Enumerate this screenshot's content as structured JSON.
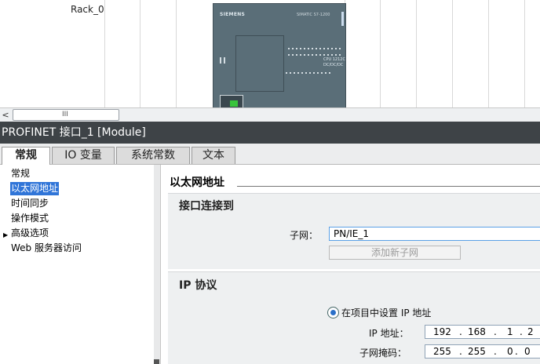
{
  "device_view": {
    "rack_label": "Rack_0",
    "plc": {
      "brand": "SIEMENS",
      "model": "SIMATIC S7-1200",
      "cpu_lines": [
        "CPU 1212C",
        "DC/DC/DC"
      ]
    }
  },
  "scrollbar": {
    "left_arrow": "<",
    "grip": "III"
  },
  "inspector": {
    "title": "PROFINET 接口_1 [Module]",
    "tabs": [
      {
        "label": "常规",
        "active": true
      },
      {
        "label": "IO 变量",
        "active": false
      },
      {
        "label": "系统常数",
        "active": false
      },
      {
        "label": "文本",
        "active": false
      }
    ]
  },
  "nav": {
    "items": [
      {
        "label": "常规",
        "selected": false
      },
      {
        "label": "以太网地址",
        "selected": true
      },
      {
        "label": "时间同步",
        "selected": false
      },
      {
        "label": "操作模式",
        "selected": false
      },
      {
        "label": "高级选项",
        "selected": false
      },
      {
        "label": "Web 服务器访问",
        "selected": false
      }
    ],
    "expand_arrow": "▶"
  },
  "content": {
    "section_title": "以太网地址",
    "interface_group": {
      "title": "接口连接到",
      "subnet_label": "子网：",
      "subnet_value": "PN/IE_1",
      "add_subnet_button": "添加新子网"
    },
    "ip_group": {
      "title": "IP 协议",
      "radio_label": "在项目中设置 IP 地址",
      "ip_label": "IP 地址：",
      "ip_segments": [
        "192",
        "168",
        "1",
        "2"
      ],
      "mask_label": "子网掩码：",
      "mask_segments": [
        "255",
        "255",
        "0",
        "0"
      ],
      "separator": "."
    }
  }
}
